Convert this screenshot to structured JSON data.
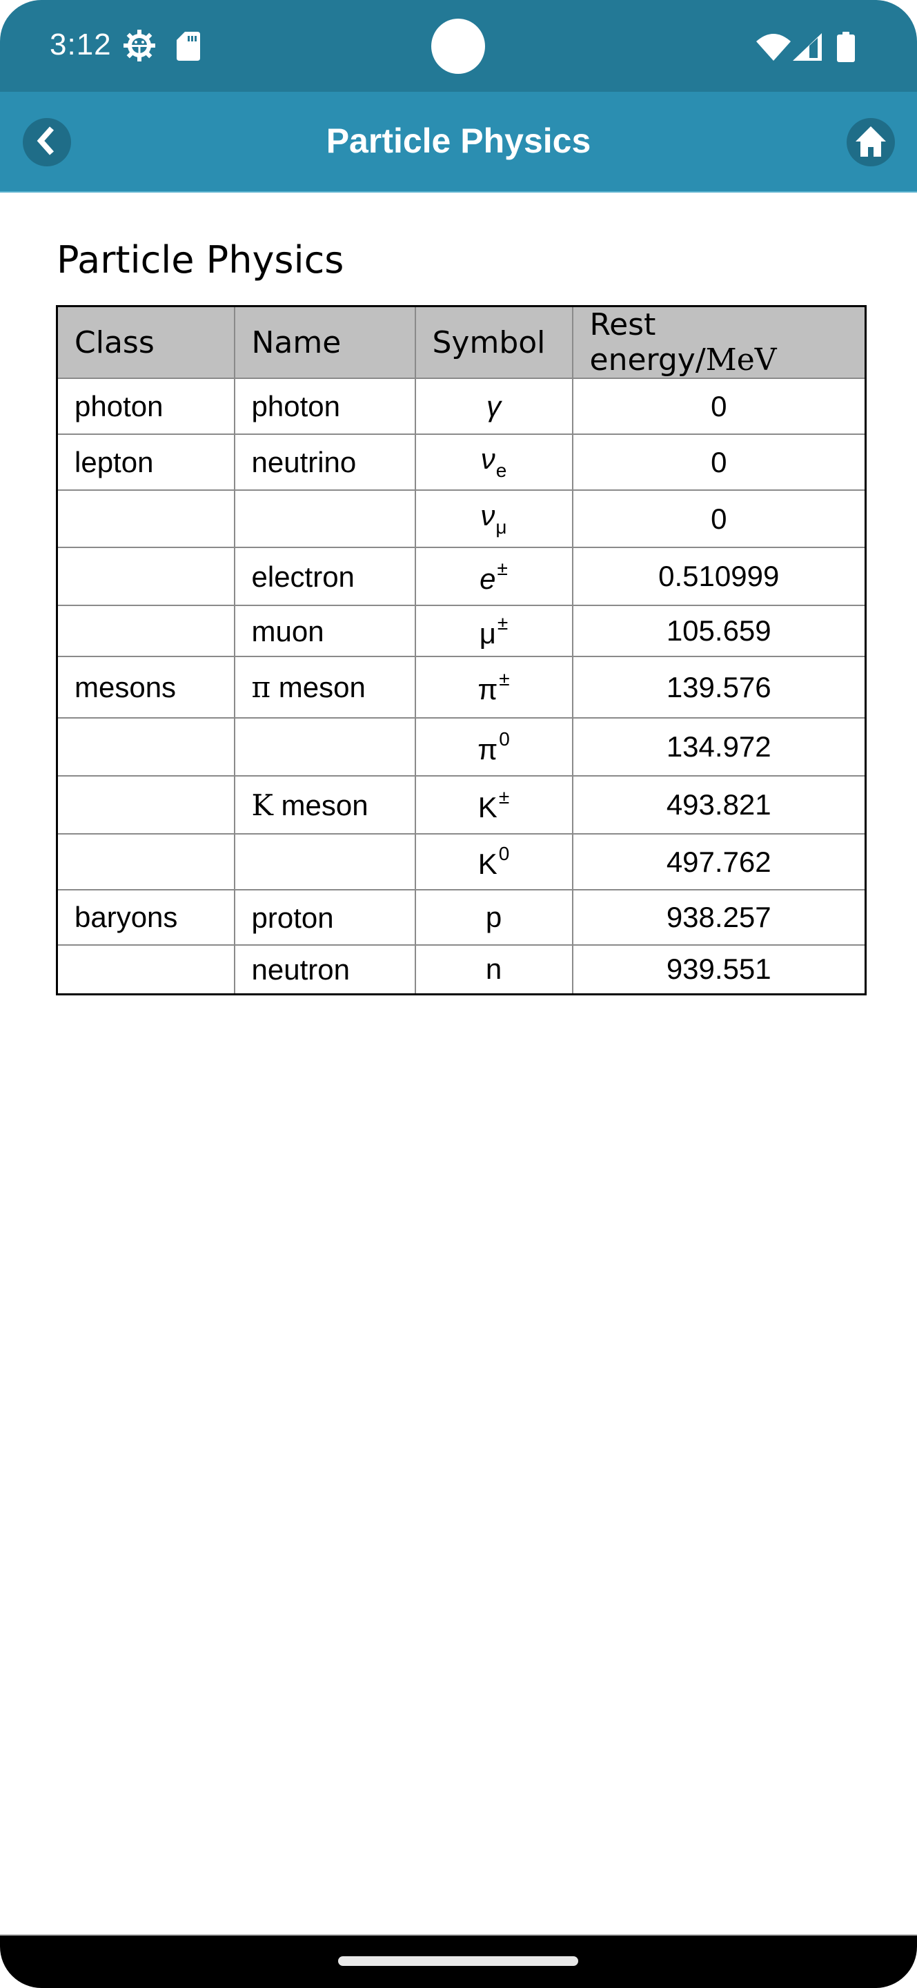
{
  "status_bar": {
    "time": "3:12",
    "left_icons": [
      "settings-gear-icon",
      "sd-card-icon"
    ],
    "right_icons": [
      "wifi-icon",
      "cellular-signal-icon",
      "battery-icon"
    ]
  },
  "app_bar": {
    "title": "Particle Physics",
    "back_icon": "chevron-left-icon",
    "home_icon": "home-icon"
  },
  "content": {
    "heading": "Particle Physics",
    "table": {
      "headers": {
        "class": "Class",
        "name": "Name",
        "symbol": "Symbol",
        "energy_label": "Rest energy/",
        "energy_unit": "MeV"
      },
      "rows": [
        {
          "class": "photon",
          "name_prefix": "",
          "name": "photon",
          "symbol": "γ",
          "symbol_italic": true,
          "sub": "",
          "sup": "",
          "energy": "0"
        },
        {
          "class": "lepton",
          "name_prefix": "",
          "name": "neutrino",
          "symbol": "ν",
          "symbol_italic": true,
          "sub": "e",
          "sup": "",
          "energy": "0"
        },
        {
          "class": "",
          "name_prefix": "",
          "name": "",
          "symbol": "ν",
          "symbol_italic": true,
          "sub": "μ",
          "sup": "",
          "energy": "0"
        },
        {
          "class": "",
          "name_prefix": "",
          "name": "electron",
          "symbol": "e",
          "symbol_italic": true,
          "sub": "",
          "sup": "±",
          "energy": "0.510999"
        },
        {
          "class": "",
          "name_prefix": "",
          "name": "muon",
          "symbol": "μ",
          "symbol_italic": false,
          "sub": "",
          "sup": "±",
          "energy": "105.659"
        },
        {
          "class": "mesons",
          "name_prefix": "π",
          "name": " meson",
          "symbol": "π",
          "symbol_italic": false,
          "sub": "",
          "sup": "±",
          "energy": "139.576"
        },
        {
          "class": "",
          "name_prefix": "",
          "name": "",
          "symbol": "π",
          "symbol_italic": false,
          "sub": "",
          "sup": "0",
          "energy": "134.972"
        },
        {
          "class": "",
          "name_prefix": "K",
          "name": " meson",
          "symbol": "K",
          "symbol_italic": false,
          "sub": "",
          "sup": "±",
          "energy": "493.821"
        },
        {
          "class": "",
          "name_prefix": "",
          "name": "",
          "symbol": "K",
          "symbol_italic": false,
          "sub": "",
          "sup": "0",
          "energy": "497.762"
        },
        {
          "class": "baryons",
          "name_prefix": "",
          "name": "proton",
          "symbol": "p",
          "symbol_italic": false,
          "sub": "",
          "sup": "",
          "energy": "938.257"
        },
        {
          "class": "",
          "name_prefix": "",
          "name": "neutron",
          "symbol": "n",
          "symbol_italic": false,
          "sub": "",
          "sup": "",
          "energy": "939.551"
        }
      ]
    }
  },
  "colors": {
    "status_bar": "#237996",
    "app_bar": "#2b8eb1",
    "button_circle": "#1f6d88",
    "table_header_bg": "#c0c0c0"
  }
}
